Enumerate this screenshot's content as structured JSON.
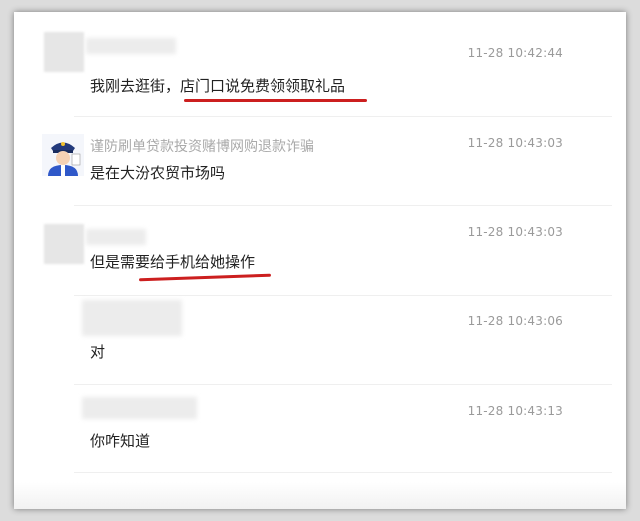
{
  "messages": [
    {
      "time": "11-28 10:42:44",
      "text": "我刚去逛街，店门口说免费领领取礼品"
    },
    {
      "sender": "谨防刷单贷款投资赌博网购退款诈骗",
      "time": "11-28 10:43:03",
      "text": "是在大汾农贸市场吗"
    },
    {
      "time": "11-28 10:43:03",
      "text": "但是需要给手机给她操作"
    },
    {
      "time": "11-28 10:43:06",
      "text": "对"
    },
    {
      "time": "11-28 10:43:13",
      "text": "你咋知道"
    }
  ],
  "colors": {
    "highlight": "#cc1f1f",
    "timestamp": "#9a9a9a",
    "text": "#222222"
  },
  "icons": {
    "police_avatar": "police-officer-icon"
  }
}
